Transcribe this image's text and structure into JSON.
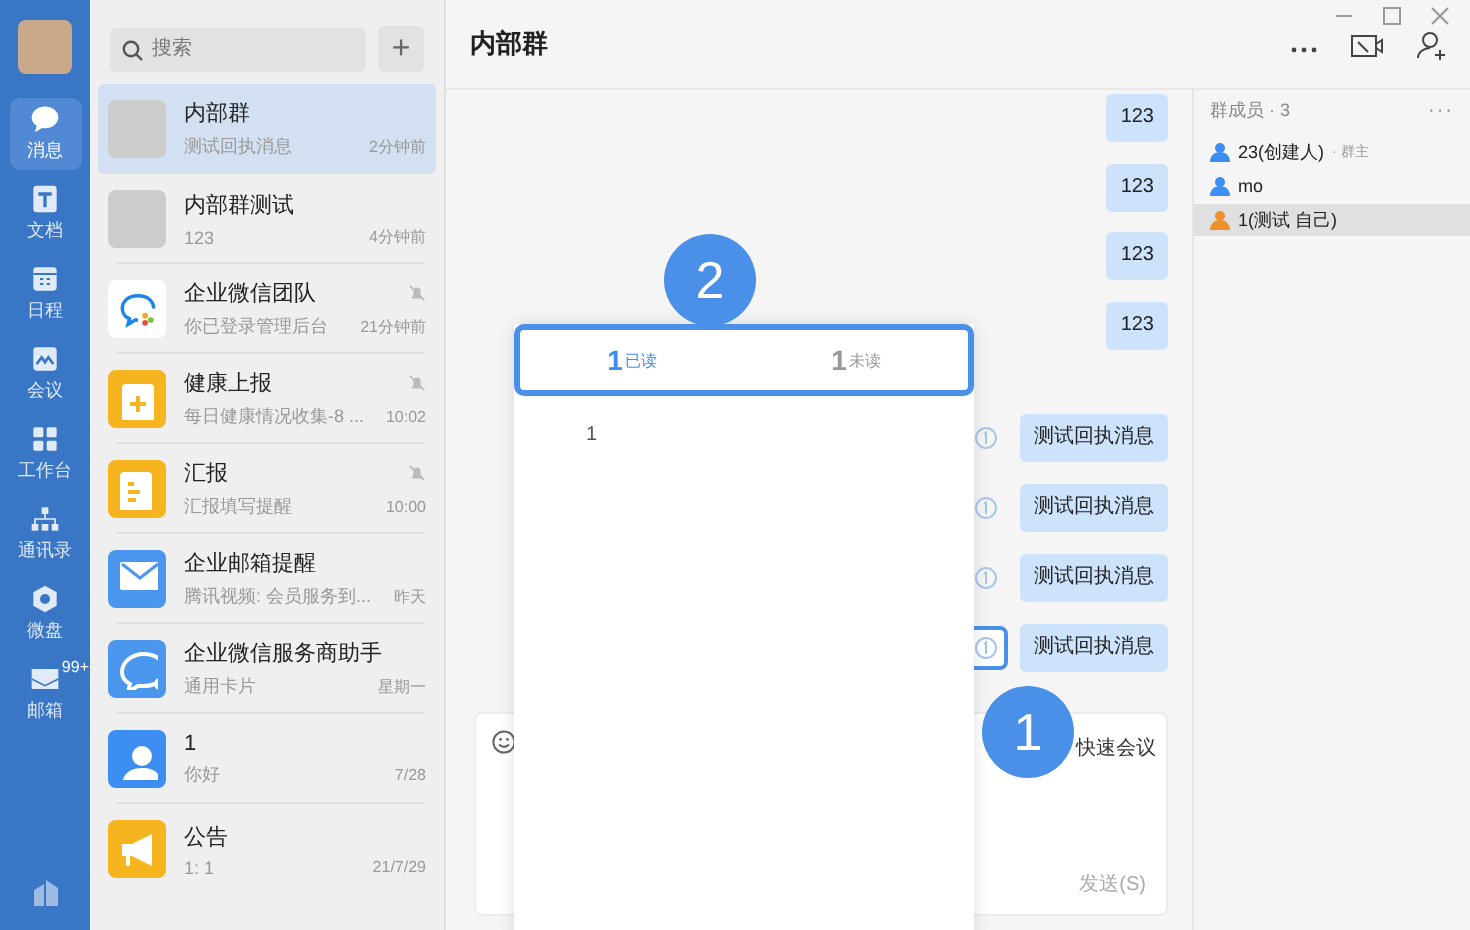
{
  "nav": {
    "items": [
      {
        "label": "消息",
        "kind": "chat",
        "selected": true
      },
      {
        "label": "文档",
        "kind": "doc",
        "selected": false
      },
      {
        "label": "日程",
        "kind": "calendar",
        "selected": false
      },
      {
        "label": "会议",
        "kind": "meeting",
        "selected": false
      },
      {
        "label": "工作台",
        "kind": "apps",
        "selected": false
      },
      {
        "label": "通讯录",
        "kind": "contacts",
        "selected": false
      },
      {
        "label": "微盘",
        "kind": "disk",
        "selected": false
      },
      {
        "label": "邮箱",
        "kind": "mail",
        "selected": false,
        "badge": "99+"
      }
    ]
  },
  "search": {
    "placeholder": "搜索",
    "add_button": "+"
  },
  "conversations": [
    {
      "name": "内部群",
      "preview": "测试回执消息",
      "time": "2分钟前",
      "kind": "group",
      "muted": false,
      "selected": true
    },
    {
      "name": "内部群测试",
      "preview": "123",
      "time": "4分钟前",
      "kind": "group",
      "muted": false,
      "selected": false
    },
    {
      "name": "企业微信团队",
      "preview": "你已登录管理后台",
      "time": "21分钟前",
      "kind": "logo",
      "muted": true,
      "selected": false
    },
    {
      "name": "健康上报",
      "preview": "每日健康情况收集-8 ...",
      "time": "10:02",
      "kind": "form",
      "muted": true,
      "selected": false
    },
    {
      "name": "汇报",
      "preview": "汇报填写提醒",
      "time": "10:00",
      "kind": "report",
      "muted": true,
      "selected": false
    },
    {
      "name": "企业邮箱提醒",
      "preview": "腾讯视频: 会员服务到...",
      "time": "昨天",
      "kind": "mail",
      "muted": false,
      "selected": false
    },
    {
      "name": "企业微信服务商助手",
      "preview": "通用卡片",
      "time": "星期一",
      "kind": "bubble",
      "muted": false,
      "selected": false
    },
    {
      "name": "1",
      "preview": "你好",
      "time": "7/28",
      "kind": "person",
      "muted": false,
      "selected": false
    },
    {
      "name": "公告",
      "preview": "1: 1",
      "time": "21/7/29",
      "kind": "megaphone",
      "muted": false,
      "selected": false
    }
  ],
  "chat": {
    "title": "内部群",
    "messages": [
      {
        "text": "123",
        "receipt": false,
        "highlighted": false
      },
      {
        "text": "123",
        "receipt": false,
        "highlighted": false
      },
      {
        "text": "123",
        "receipt": false,
        "highlighted": false
      },
      {
        "text": "123",
        "receipt": false,
        "highlighted": false
      },
      {
        "text": "测试回执消息",
        "receipt": true,
        "highlighted": false
      },
      {
        "text": "测试回执消息",
        "receipt": true,
        "highlighted": false
      },
      {
        "text": "测试回执消息",
        "receipt": true,
        "highlighted": false
      },
      {
        "text": "测试回执消息",
        "receipt": true,
        "highlighted": true
      }
    ],
    "input": {
      "quick_meeting": "快速会议",
      "send": "发送(S)"
    }
  },
  "read_popup": {
    "tabs": [
      {
        "count": "1",
        "label": "已读",
        "selected": true
      },
      {
        "count": "1",
        "label": "未读",
        "selected": false
      }
    ],
    "readers": [
      "1"
    ]
  },
  "members": {
    "header": "群成员 · 3",
    "more": "···",
    "items": [
      {
        "name": "23(创建人)",
        "tag": "· 群主",
        "color": "#3d8ef2",
        "selected": false
      },
      {
        "name": "mo",
        "color": "#3d8ef2",
        "selected": false
      },
      {
        "name": "1(测试 自己)",
        "color": "#f0902a",
        "selected": true
      }
    ]
  },
  "callouts": [
    {
      "number": "2"
    },
    {
      "number": "1"
    }
  ]
}
